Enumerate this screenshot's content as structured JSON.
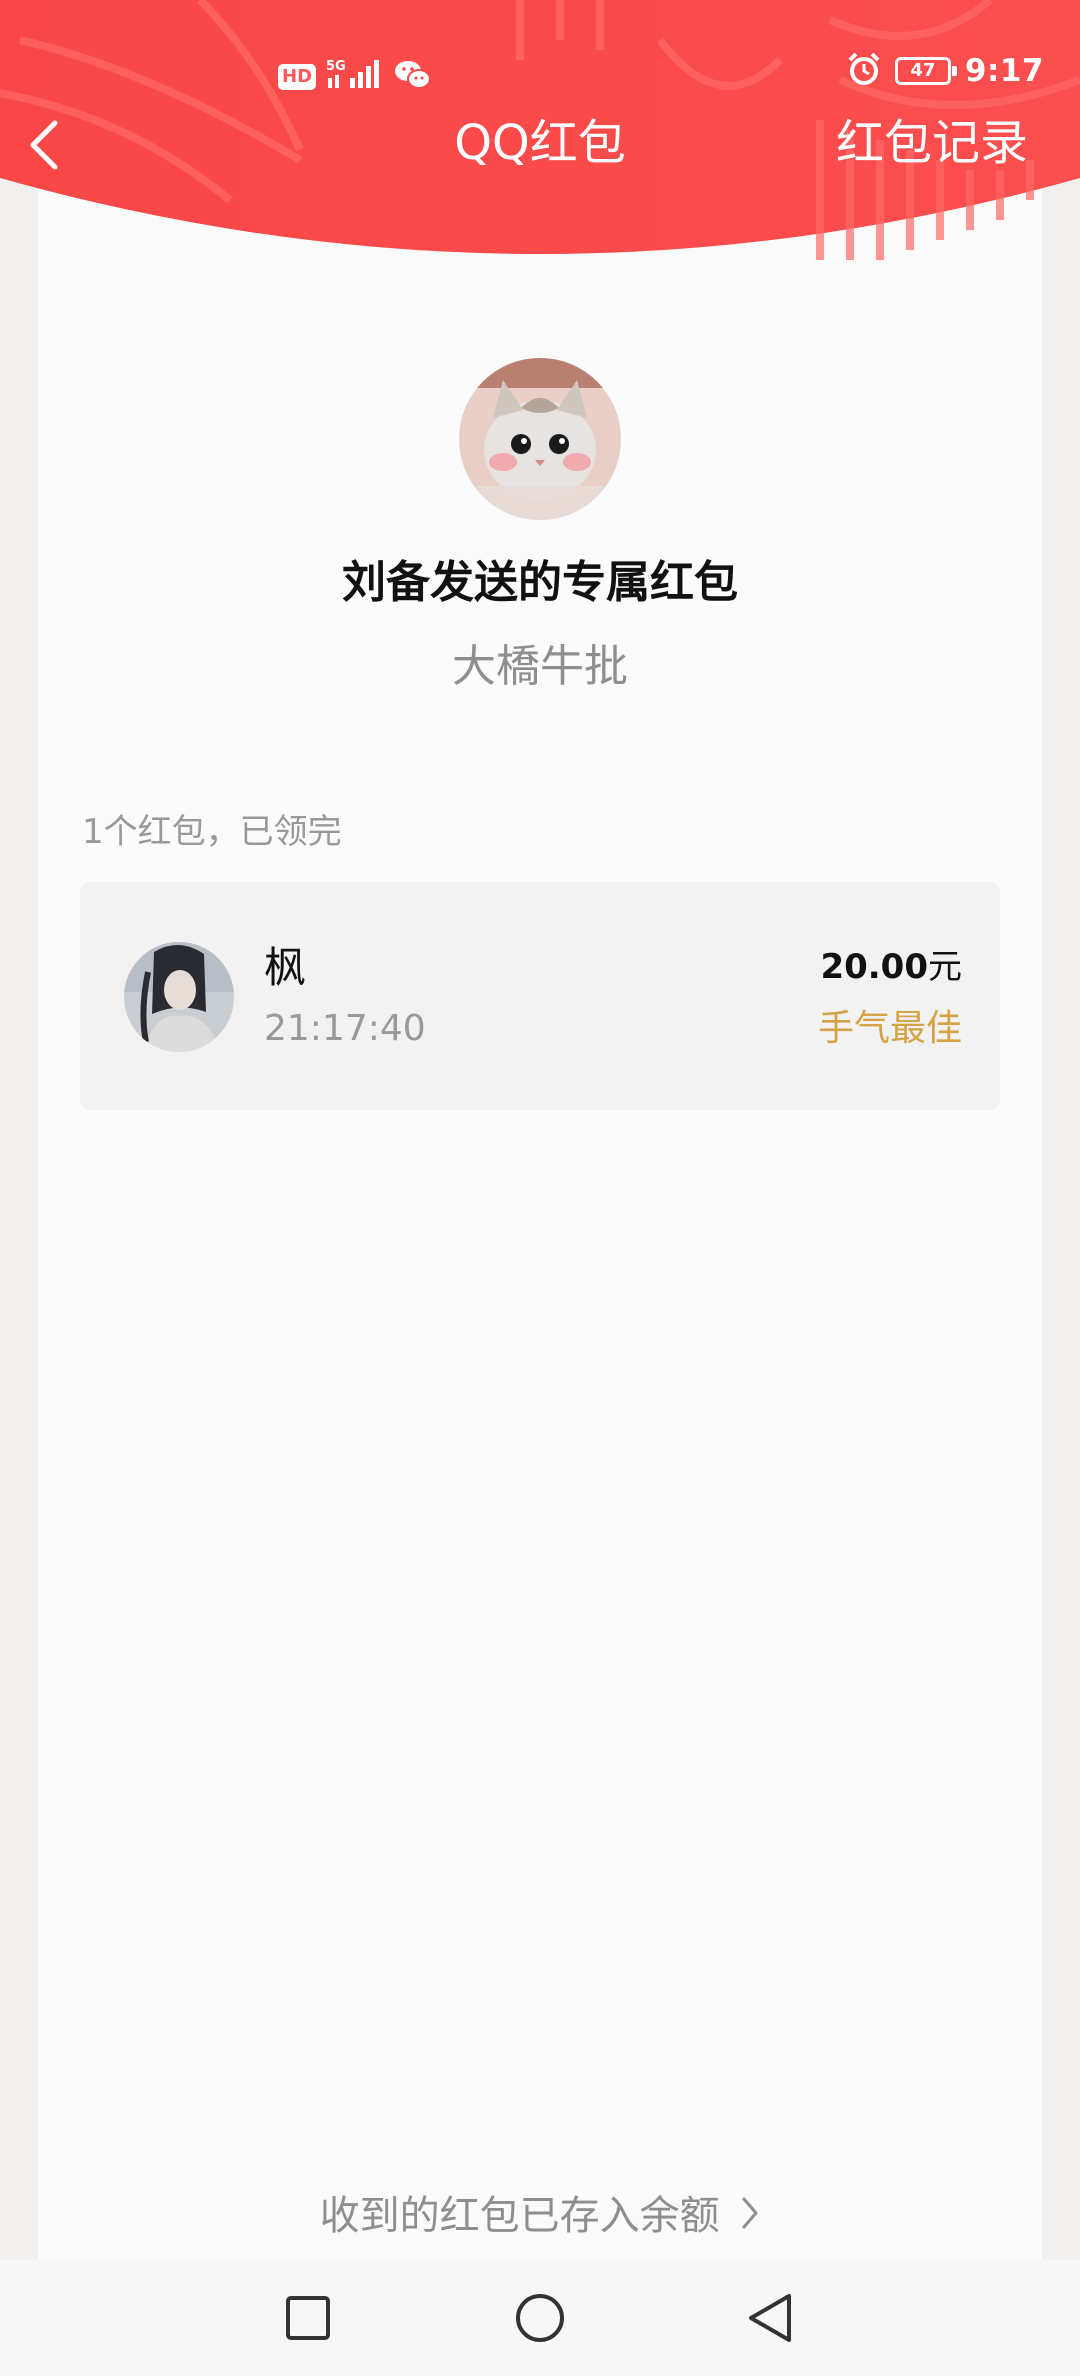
{
  "status_bar": {
    "hd_label": "HD",
    "network_label": "5G",
    "battery_level": "47",
    "time": "9:17"
  },
  "nav": {
    "title": "QQ红包",
    "records_label": "红包记录"
  },
  "packet": {
    "sender_title": "刘备发送的专属红包",
    "blessing": "大橋牛批",
    "summary": "1个红包，已领完"
  },
  "records": [
    {
      "name": "枫",
      "time": "21:17:40",
      "amount": "20.00",
      "unit": "元",
      "badge": "手气最佳"
    }
  ],
  "footer": {
    "balance_link": "收到的红包已存入余额"
  },
  "colors": {
    "header_red": "#fa4a4a",
    "best_luck_gold": "#d5a244",
    "muted_text": "#8e8e8e"
  },
  "icons": {
    "back": "chevron-left-icon",
    "alarm": "alarm-icon",
    "wechat": "wechat-icon",
    "signal": "signal-icon",
    "footer_arrow": "chevron-right-icon",
    "recent_apps": "square-icon",
    "home": "circle-icon",
    "back_nav": "triangle-back-icon"
  }
}
